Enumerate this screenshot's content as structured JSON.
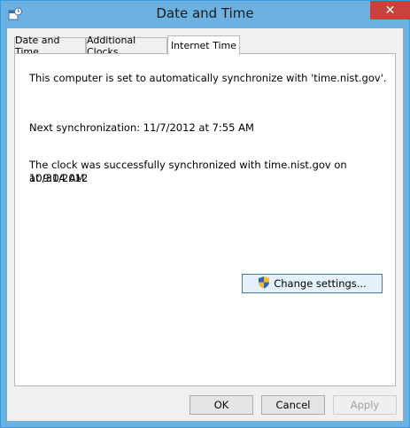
{
  "window": {
    "title": "Date and Time",
    "close_glyph": "✕"
  },
  "tabs": [
    {
      "label": "Date and Time"
    },
    {
      "label": "Additional Clocks"
    },
    {
      "label": "Internet Time"
    }
  ],
  "panel": {
    "sync_server_text": "This computer is set to automatically synchronize with 'time.nist.gov'.",
    "next_sync_text": "Next synchronization: 11/7/2012 at 7:55 AM",
    "last_sync_line1": "The clock was successfully synchronized with time.nist.gov on 10/31/2012",
    "last_sync_line2": "at 9:04 AM.",
    "change_settings_label": "Change settings..."
  },
  "footer": {
    "ok_label": "OK",
    "cancel_label": "Cancel",
    "apply_label": "Apply"
  },
  "icons": {
    "title_icon": "date-time-icon",
    "shield_icon": "uac-shield-icon"
  },
  "colors": {
    "titlebar": "#6bb2e3",
    "close_button": "#c7423c",
    "dialog_background": "#f0f0f0"
  }
}
